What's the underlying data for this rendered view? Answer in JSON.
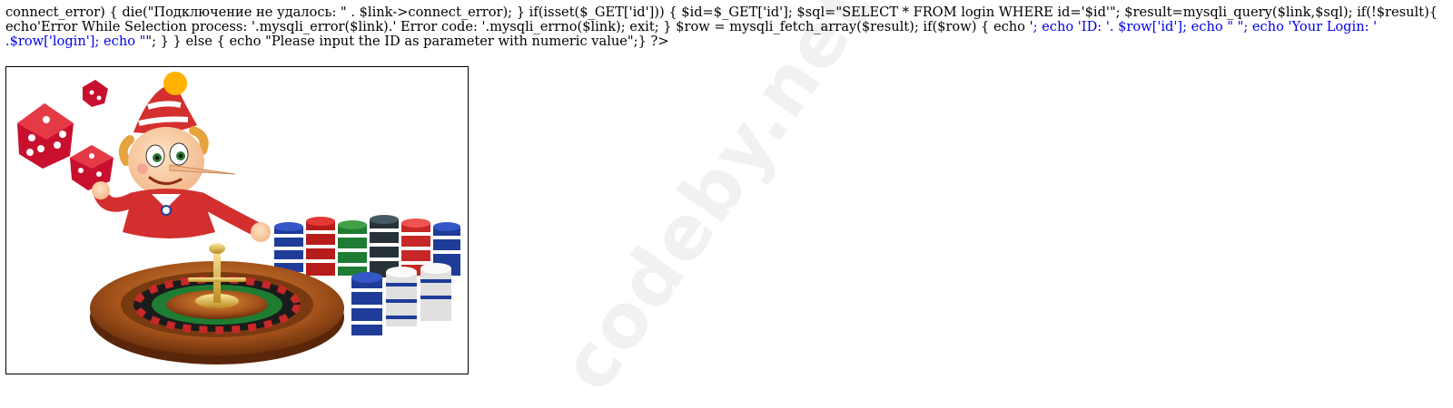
{
  "php_output": {
    "code_text": "connect_error) { die(\"Подключение не удалось: \" . $link->connect_error); } if(isset($_GET['id'])) { $id=$_GET['id']; $sql=\"SELECT * FROM login WHERE id='$id'\"; $result=mysqli_query($link,$sql); if(!$result){ echo'Error While Selection process: '.mysqli_error($link).' Error code: '.mysqli_errno($link); exit; } $row = mysqli_fetch_array($result); if($row) { echo '",
    "blue_text": "; echo 'ID: '. $row['id']; echo \" \"; echo 'Your Login: ' .$row['login']; echo \"",
    "tail_text": "\"; } } else { echo \"Please input the ID as parameter with numeric value\";} ?>"
  },
  "banner": {
    "description": "Pinocchio-style cartoon character with casino roulette wheel, red dice and poker chip stacks"
  },
  "watermark": {
    "text": "codeby.net"
  },
  "colors": {
    "leaked_html_text": "#0000ee",
    "page_background": "#ffffff"
  }
}
